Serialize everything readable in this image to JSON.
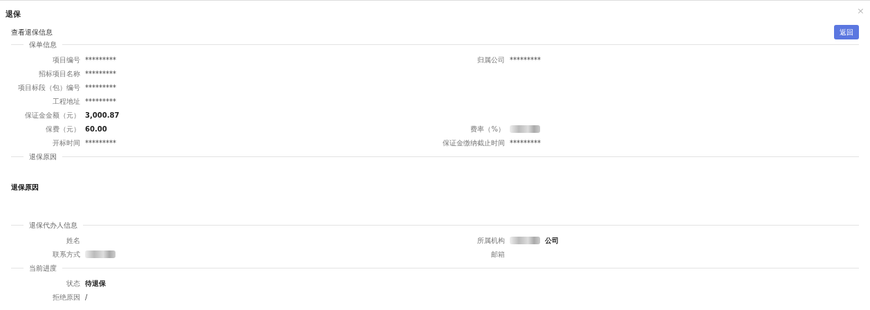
{
  "dialog": {
    "title": "退保",
    "close": "×"
  },
  "header": {
    "subtitle": "查看退保信息",
    "back_button": "返回"
  },
  "sections": [
    {
      "title": "保单信息",
      "kind": "fields",
      "rows": [
        [
          {
            "label": "项目编号",
            "value": "*********",
            "strong": false,
            "redacted": false
          },
          {
            "label": "归属公司",
            "value": "*********",
            "strong": false,
            "redacted": false
          }
        ],
        [
          {
            "label": "招标项目名称",
            "value": "*********",
            "strong": false,
            "redacted": false
          }
        ],
        [
          {
            "label": "项目标段（包）编号",
            "value": "*********",
            "strong": false,
            "redacted": false
          }
        ],
        [
          {
            "label": "工程地址",
            "value": "*********",
            "strong": false,
            "redacted": false
          }
        ],
        [
          {
            "label": "保证金金额（元）",
            "value": "3,000.87",
            "strong": true,
            "redacted": false
          }
        ],
        [
          {
            "label": "保费（元）",
            "value": "60.00",
            "strong": true,
            "redacted": false
          },
          {
            "label": "费率（%）",
            "redacted": true
          }
        ],
        [
          {
            "label": "开标时间",
            "value": "*********",
            "strong": false,
            "redacted": false
          },
          {
            "label": "保证金缴纳截止时间",
            "value": "*********",
            "strong": false,
            "redacted": false
          }
        ]
      ]
    },
    {
      "title": "退保原因",
      "kind": "text",
      "text": "退保原因"
    },
    {
      "title": "退保代办人信息",
      "kind": "fields",
      "rows": [
        [
          {
            "label": "姓名",
            "redacted": false
          },
          {
            "label": "所属机构",
            "value": "公司",
            "strong": true,
            "redacted": true
          }
        ],
        [
          {
            "label": "联系方式",
            "redacted": true
          },
          {
            "label": "邮箱",
            "redacted": false
          }
        ]
      ]
    },
    {
      "title": "当前进度",
      "kind": "fields",
      "rows": [
        [
          {
            "label": "状态",
            "value": "待退保",
            "strong": true,
            "redacted": false
          }
        ],
        [
          {
            "label": "拒绝原因",
            "value": "/",
            "strong": false,
            "redacted": false
          }
        ]
      ]
    }
  ]
}
